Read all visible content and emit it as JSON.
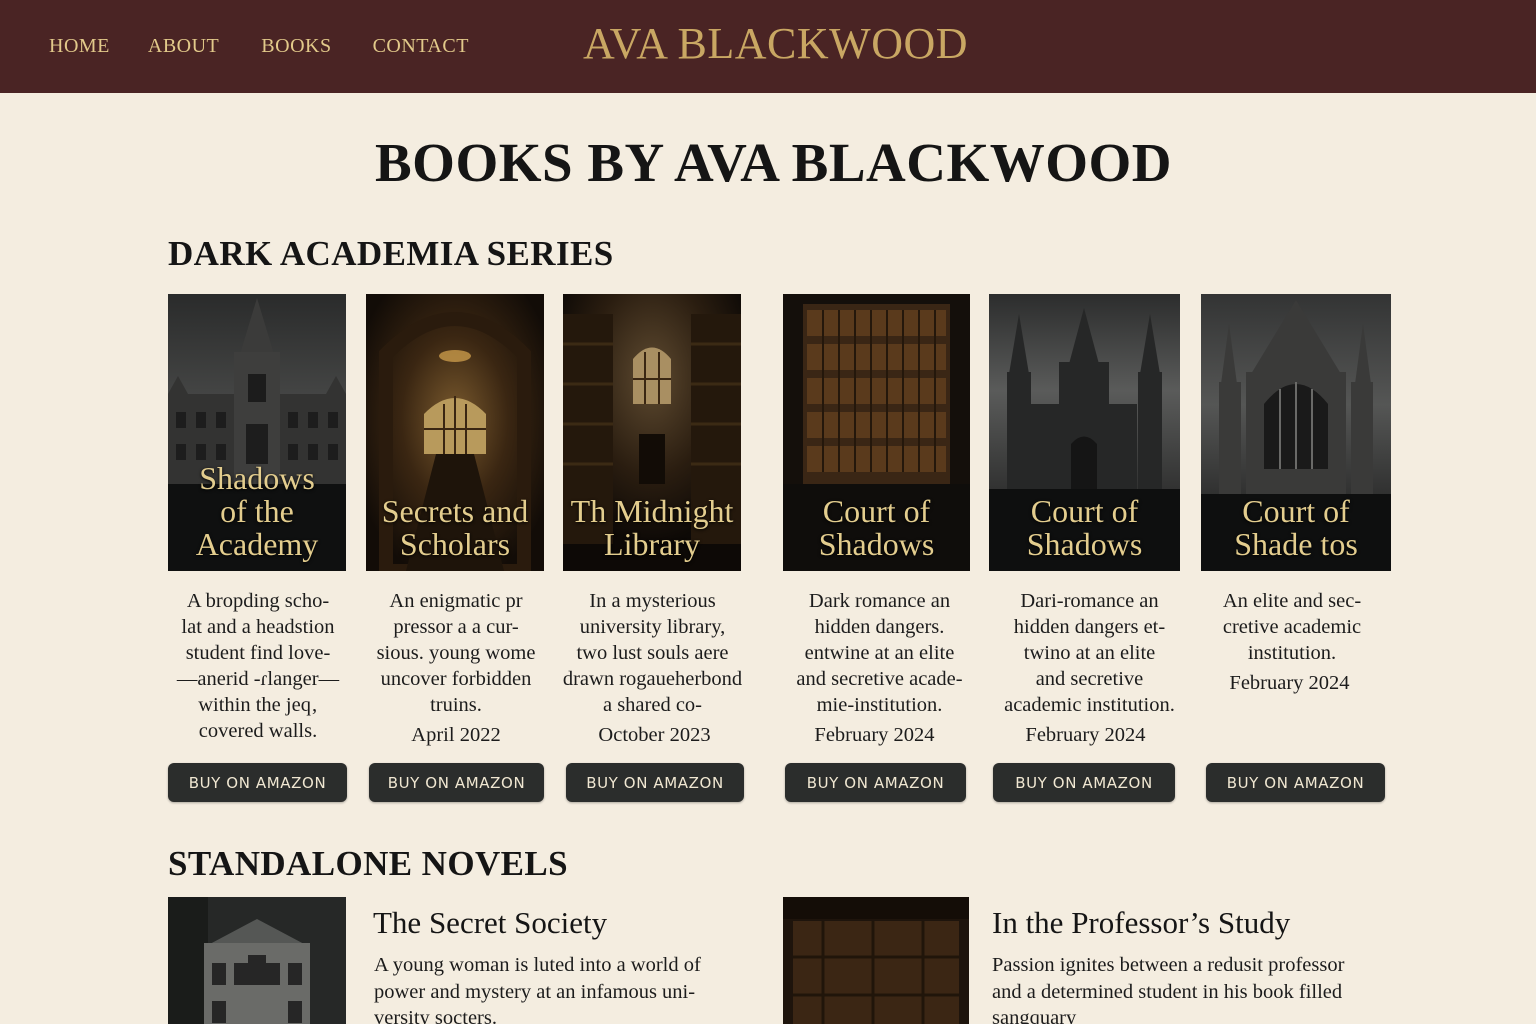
{
  "header": {
    "nav": [
      "HOME",
      "ABOUT",
      "BOOKS",
      "CONTACT"
    ],
    "brand": "AVA BLACKWOOD"
  },
  "page_title": "BOOKS BY AVA BLACKWOOD",
  "series": {
    "title": "DARK ACADEMIA SERIES",
    "books": [
      {
        "cover_title": "Shadows\nof the Academy",
        "description": "A bropding scho-\nlat and a headstion\nstudent find love-\n—anerid -ɾlanger—\nwithin the jeq‚\ncovered walls.",
        "date": "",
        "button": "BUY ON AMAZON"
      },
      {
        "cover_title": "Secrets and\nScholars",
        "description": "An enigmatic pr\npressor a a cur-\nsious. young wome\nuncover forbidden\ntruins.",
        "date": "April 2022",
        "button": "BUY ON AMAZON"
      },
      {
        "cover_title": "Th Midnight\nLibrary",
        "description": "In a mysterious\nuniversity library,\ntwo lust souls aere\ndrawn rogaueherbond\na shared co-",
        "date": "October 2023",
        "button": "BUY ON AMAZON"
      },
      {
        "cover_title": "Court of\nShadows",
        "description": "Dark romance an\nhidden dangers.\nentwine at an elite\nand secretive acade-\nmie-institution.",
        "date": "February 2024",
        "button": "BUY ON AMAZON"
      },
      {
        "cover_title": "Court of\nShadows",
        "description": "Dari-romance an\nhidden dangers et-\ntwino at an elite\nand secretive\nacademic institution.",
        "date": "February 2024",
        "button": "BUY ON AMAZON"
      },
      {
        "cover_title": "Court of\nShade tos",
        "description": "An elite and sec-\ncretive academic\ninstitution.",
        "date": "February 2024",
        "button": "BUY ON AMAZON"
      }
    ]
  },
  "standalone": {
    "title": "STANDALONE NOVELS",
    "books": [
      {
        "title": "The Secret Society",
        "description": "A young woman is luted into a world of\npower and mystery at an infamous uni-\nversity socters."
      },
      {
        "title": "In the Professor’s Study",
        "description": "Passion ignites between a redusit professor\nand a determined student in his book filled\nsangquary"
      }
    ]
  },
  "colors": {
    "header_bg": "#4a2424",
    "nav_text": "#e2c98a",
    "brand_gold": "#c9a763",
    "page_bg": "#f4ede0",
    "button_bg": "#2b2d2c"
  }
}
